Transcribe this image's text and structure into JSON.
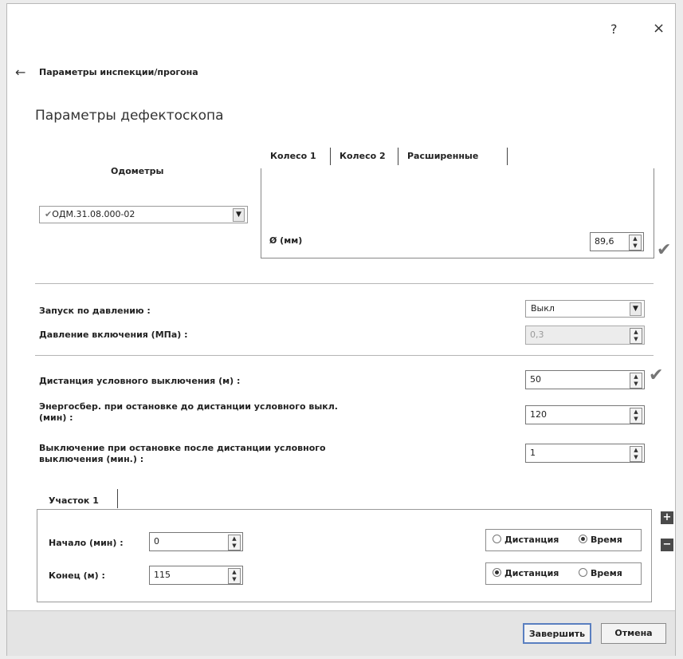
{
  "window": {
    "help_label": "?",
    "close_label": "×"
  },
  "header": {
    "back_icon": "arrow-left-icon",
    "breadcrumb": "Параметры инспекции/прогона",
    "page_title": "Параметры дефектоскопа"
  },
  "odometers": {
    "label": "Одометры",
    "selected": "ОДМ.31.08.000-02",
    "check_icon": "checkmark-icon"
  },
  "tabs": [
    {
      "label": "Колесо 1",
      "active": true
    },
    {
      "label": "Колесо 2",
      "active": false
    },
    {
      "label": "Расширенные",
      "active": false
    }
  ],
  "wheel": {
    "diameter_label": "Ø (мм)",
    "diameter_value": "89,6"
  },
  "pressure": {
    "start_label": "Запуск по давлению :",
    "start_value": "Выкл",
    "on_pressure_label": "Давление включения (МПа) :",
    "on_pressure_value": "0,3"
  },
  "shutdown": {
    "distance_label": "Дистанция условного выключения (м) :",
    "distance_value": "50",
    "energy_label_line1": "Энергосбер. при остановке до дистанции условного выкл.",
    "energy_label_line2": "(мин) :",
    "energy_value": "120",
    "off_label_line1": "Выключение при остановке после дистанции условного",
    "off_label_line2": "выключения (мин.) :",
    "off_value": "1"
  },
  "section": {
    "tab_label": "Участок 1",
    "start_label": "Начало (мин) :",
    "start_value": "0",
    "end_label": "Конец (м) :",
    "end_value": "115",
    "radio_distance": "Дистанция",
    "radio_time": "Время",
    "start_mode": "Время",
    "end_mode": "Дистанция",
    "add_icon": "plus-icon",
    "remove_icon": "minus-icon"
  },
  "footer": {
    "finish_label": "Завершить",
    "cancel_label": "Отмена"
  }
}
